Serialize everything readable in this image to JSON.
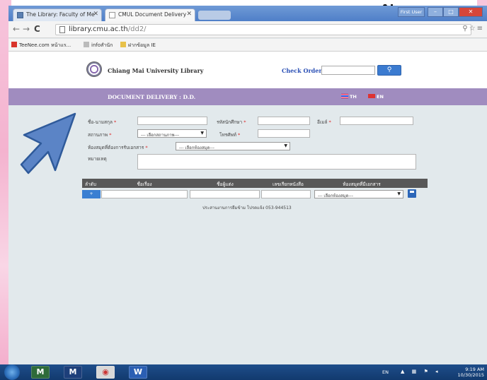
{
  "slide": {
    "corner_glyph": "น"
  },
  "browser": {
    "tabs": [
      {
        "label": "The Library: Faculty of Me"
      },
      {
        "label": "CMUL Document Delivery"
      }
    ],
    "window_controls": {
      "user_label": "First User",
      "minimize": "–",
      "maximize": "□",
      "close": "✕"
    },
    "url_host": "library.cmu.ac.th",
    "url_path": "/dd2/",
    "bookmarks": [
      {
        "label": "TeeNee.com หน้าแร..."
      },
      {
        "label": "infoสำนัก"
      },
      {
        "label": "ฝากข้อมูล IE"
      }
    ]
  },
  "header": {
    "library_name": "Chiang Mai University Library",
    "check_order_label": "Check Order",
    "search_button_icon": "search-icon"
  },
  "banner": {
    "title": "DOCUMENT DELIVERY : D.D.",
    "lang_th": "TH",
    "lang_en": "EN"
  },
  "form": {
    "name_label": "ชื่อ-นามสกุล",
    "student_id_label": "รหัสนักศึกษา",
    "email_label": "อีเมล์",
    "status_label": "สถานภาพ",
    "status_select": "--- เลือกสถานภาพ---",
    "phone_label": "โทรศัพท์",
    "library_label": "ห้องสมุดที่ต้องการรับเอกสาร",
    "library_select": "--- เลือกห้องสมุด---",
    "note_label": "หมายเหตุ",
    "required_mark": "*"
  },
  "table": {
    "headers": [
      "ลำดับ",
      "ชื่อเรื่อง",
      "ชื่อผู้แต่ง",
      "เลขเรียกหนังสือ",
      "ห้องสมุดที่มีเอกสาร"
    ],
    "row": {
      "add_button": "+",
      "library_select": "--- เลือกห้องสมุด---"
    }
  },
  "footer_note": "ประสานงานการยืมข้าม โปรดแจ้ง 053-944513",
  "taskbar": {
    "lang": "EN",
    "time": "9:19 AM",
    "date": "10/30/2015"
  }
}
